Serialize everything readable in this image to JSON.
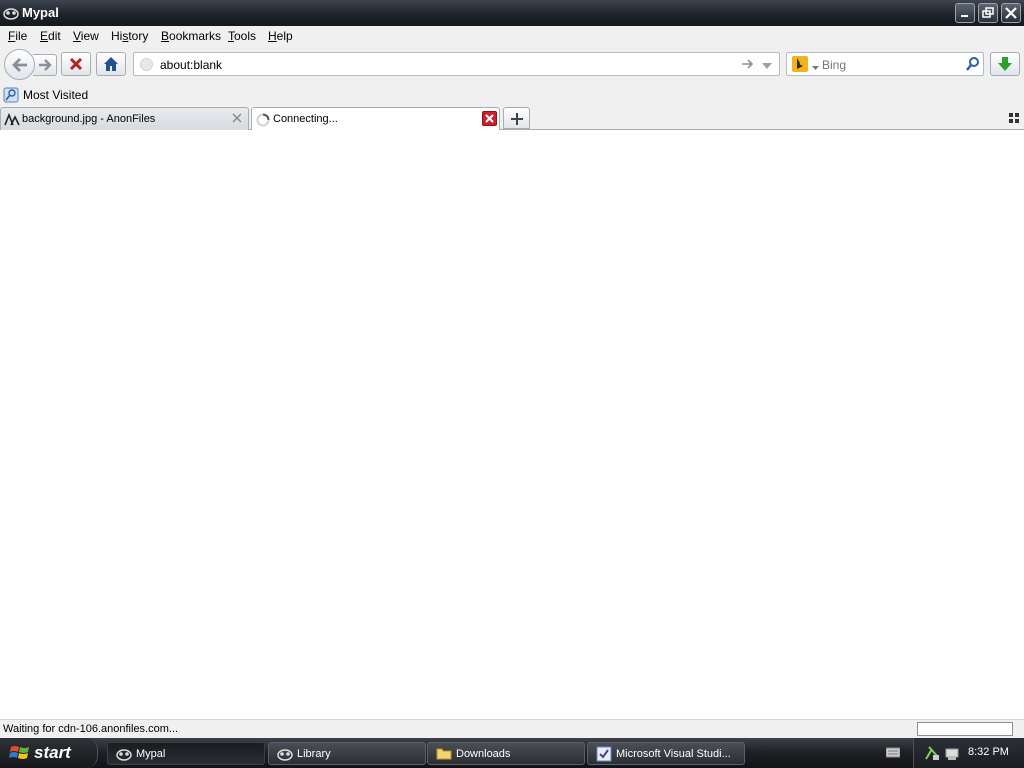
{
  "window": {
    "title": "Mypal"
  },
  "menu": {
    "items": [
      {
        "prefix": "",
        "accel": "F",
        "rest": "ile"
      },
      {
        "prefix": "",
        "accel": "E",
        "rest": "dit"
      },
      {
        "prefix": "",
        "accel": "V",
        "rest": "iew"
      },
      {
        "prefix": "Hi",
        "accel": "s",
        "rest": "tory"
      },
      {
        "prefix": "",
        "accel": "B",
        "rest": "ookmarks"
      },
      {
        "prefix": "",
        "accel": "T",
        "rest": "ools"
      },
      {
        "prefix": "",
        "accel": "H",
        "rest": "elp"
      }
    ]
  },
  "nav": {
    "url": "about:blank",
    "search_placeholder": "Bing"
  },
  "bookmarks": {
    "items": [
      {
        "label": "Most Visited"
      }
    ]
  },
  "tabs": [
    {
      "label": "background.jpg - AnonFiles"
    },
    {
      "label": "Connecting..."
    }
  ],
  "status": {
    "text": "Waiting for cdn-106.anonfiles.com..."
  },
  "taskbar": {
    "start_label": "start",
    "tasks": [
      {
        "label": "Mypal"
      },
      {
        "label": "Library"
      },
      {
        "label": "Downloads"
      },
      {
        "label": "Microsoft Visual Studi..."
      }
    ],
    "clock": "8:32 PM"
  },
  "colors": {
    "accent": "#1f242b",
    "close_red": "#c8232c",
    "bing_yellow": "#f1b21b",
    "download_green": "#2ea02e"
  }
}
